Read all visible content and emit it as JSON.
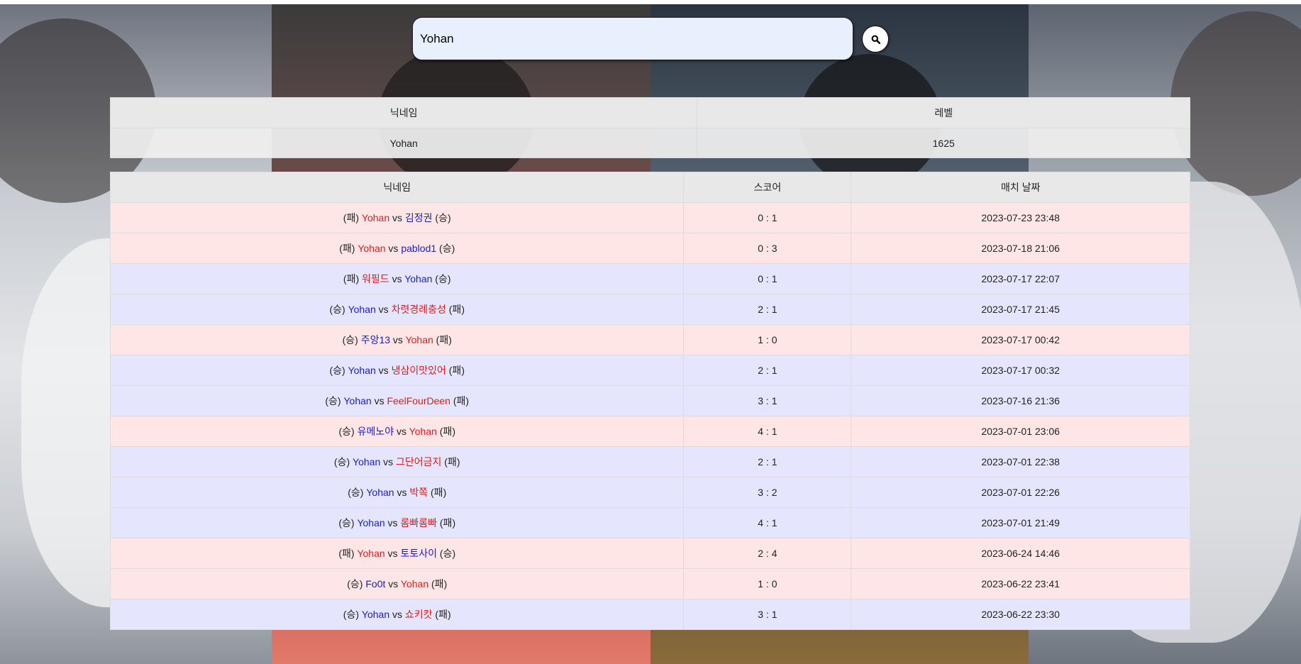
{
  "search": {
    "value": "Yohan",
    "icon": "search-icon"
  },
  "profile": {
    "headers": [
      "닉네임",
      "레벨"
    ],
    "nickname": "Yohan",
    "level": "1625"
  },
  "matches": {
    "headers": [
      "닉네임",
      "스코어",
      "매치 날짜"
    ],
    "colors": {
      "win": "#1a1ad6",
      "loss": "#e01b1b",
      "row_loss_bg": "#fee6e6",
      "row_win_bg": "#e5e5fd"
    },
    "rows": [
      {
        "p1": "Yohan",
        "r1": "패",
        "p2": "김정권",
        "r2": "승",
        "score": "0 : 1",
        "date": "2023-07-23 23:48",
        "result": "loss"
      },
      {
        "p1": "Yohan",
        "r1": "패",
        "p2": "pablod1",
        "r2": "승",
        "score": "0 : 3",
        "date": "2023-07-18 21:06",
        "result": "loss"
      },
      {
        "p1": "워필드",
        "r1": "패",
        "p2": "Yohan",
        "r2": "승",
        "score": "0 : 1",
        "date": "2023-07-17 22:07",
        "result": "win"
      },
      {
        "p1": "Yohan",
        "r1": "승",
        "p2": "차렷경례충성",
        "r2": "패",
        "score": "2 : 1",
        "date": "2023-07-17 21:45",
        "result": "win"
      },
      {
        "p1": "주앙13",
        "r1": "승",
        "p2": "Yohan",
        "r2": "패",
        "score": "1 : 0",
        "date": "2023-07-17 00:42",
        "result": "loss"
      },
      {
        "p1": "Yohan",
        "r1": "승",
        "p2": "냉삼이맛있어",
        "r2": "패",
        "score": "2 : 1",
        "date": "2023-07-17 00:32",
        "result": "win"
      },
      {
        "p1": "Yohan",
        "r1": "승",
        "p2": "FeelFourDeen",
        "r2": "패",
        "score": "3 : 1",
        "date": "2023-07-16 21:36",
        "result": "win"
      },
      {
        "p1": "유메노야",
        "r1": "승",
        "p2": "Yohan",
        "r2": "패",
        "score": "4 : 1",
        "date": "2023-07-01 23:06",
        "result": "loss"
      },
      {
        "p1": "Yohan",
        "r1": "승",
        "p2": "그단어금지",
        "r2": "패",
        "score": "2 : 1",
        "date": "2023-07-01 22:38",
        "result": "win"
      },
      {
        "p1": "Yohan",
        "r1": "승",
        "p2": "박쪽",
        "r2": "패",
        "score": "3 : 2",
        "date": "2023-07-01 22:26",
        "result": "win"
      },
      {
        "p1": "Yohan",
        "r1": "승",
        "p2": "롬빠롬빠",
        "r2": "패",
        "score": "4 : 1",
        "date": "2023-07-01 21:49",
        "result": "win"
      },
      {
        "p1": "Yohan",
        "r1": "패",
        "p2": "토토사이",
        "r2": "승",
        "score": "2 : 4",
        "date": "2023-06-24 14:46",
        "result": "loss"
      },
      {
        "p1": "Fo0t",
        "r1": "승",
        "p2": "Yohan",
        "r2": "패",
        "score": "1 : 0",
        "date": "2023-06-22 23:41",
        "result": "loss"
      },
      {
        "p1": "Yohan",
        "r1": "승",
        "p2": "쇼키캇",
        "r2": "패",
        "score": "3 : 1",
        "date": "2023-06-22 23:30",
        "result": "win"
      }
    ]
  }
}
